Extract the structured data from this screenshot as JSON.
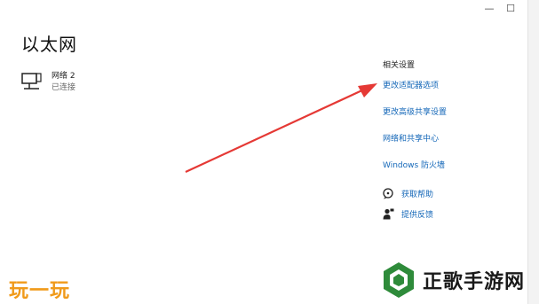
{
  "window": {
    "minimize_glyph": "—",
    "maximize_glyph": "☐"
  },
  "page": {
    "title": "以太网"
  },
  "network": {
    "name": "网络 2",
    "status": "已连接",
    "icon": "network-pc-icon"
  },
  "related_settings": {
    "heading": "相关设置",
    "links": [
      "更改适配器选项",
      "更改高级共享设置",
      "网络和共享中心",
      "Windows 防火墙"
    ]
  },
  "help": {
    "get_help": "获取帮助",
    "feedback": "提供反馈"
  },
  "watermarks": {
    "left": "玩一玩",
    "right": "正歌手游网"
  },
  "colors": {
    "link": "#1467b8",
    "arrow": "#e53935",
    "watermark_left": "#f09a1a",
    "logo_green": "#2e8b3a"
  }
}
